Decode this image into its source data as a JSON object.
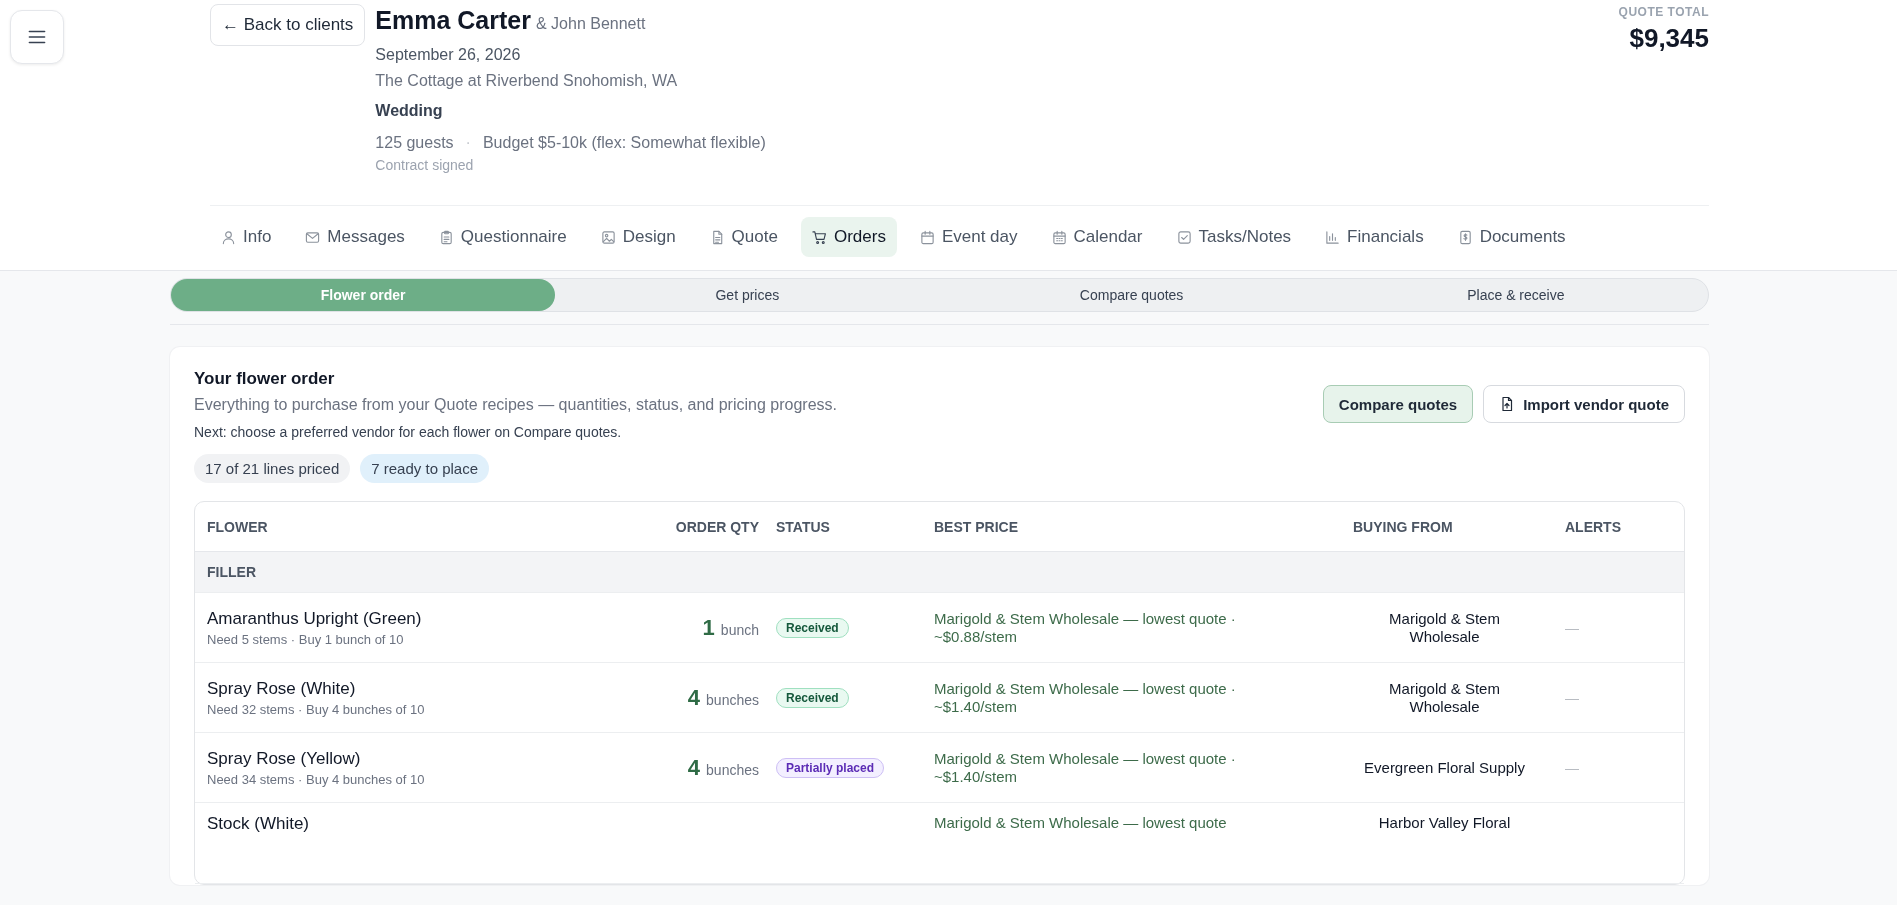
{
  "back_button": {
    "label": "← Back to clients"
  },
  "client": {
    "name": "Emma Carter",
    "partner": "& John Bennett",
    "date": "September 26, 2026",
    "venue": "The Cottage at Riverbend Snohomish, WA",
    "event_type": "Wedding",
    "guests": "125 guests",
    "separator": "·",
    "budget": "Budget $5-10k (flex: Somewhat flexible)",
    "contract": "Contract signed"
  },
  "quote_total": {
    "label": "QUOTE TOTAL",
    "value": "$9,345"
  },
  "tabs": [
    {
      "label": "Info",
      "selected": false
    },
    {
      "label": "Messages",
      "selected": false
    },
    {
      "label": "Questionnaire",
      "selected": false
    },
    {
      "label": "Design",
      "selected": false
    },
    {
      "label": "Quote",
      "selected": false
    },
    {
      "label": "Orders",
      "selected": true
    },
    {
      "label": "Event day",
      "selected": false
    },
    {
      "label": "Calendar",
      "selected": false
    },
    {
      "label": "Tasks/Notes",
      "selected": false
    },
    {
      "label": "Financials",
      "selected": false
    },
    {
      "label": "Documents",
      "selected": false
    }
  ],
  "steps": [
    {
      "label": "Flower order",
      "selected": true
    },
    {
      "label": "Get prices",
      "selected": false
    },
    {
      "label": "Compare quotes",
      "selected": false
    },
    {
      "label": "Place & receive",
      "selected": false
    }
  ],
  "order": {
    "title": "Your flower order",
    "subtitle": "Everything to purchase from your Quote recipes — quantities, status, and pricing progress.",
    "next": "Next: choose a preferred vendor for each flower on Compare quotes.",
    "buttons": [
      {
        "label": "Compare quotes",
        "kind": "primary"
      },
      {
        "label": "Import vendor quote",
        "kind": "import"
      }
    ],
    "badges": [
      {
        "label": "17 of 21 lines priced",
        "color": "#f1f2f4"
      },
      {
        "label": "7 ready to place",
        "color": "#e0f0fb"
      }
    ]
  },
  "table": {
    "columns": [
      "FLOWER",
      "ORDER QTY",
      "STATUS",
      "BEST PRICE",
      "BUYING FROM",
      "ALERTS"
    ],
    "groups": [
      {
        "name": "FILLER",
        "rows": [
          {
            "flower": "Amaranthus Upright (Green)",
            "detail": "Need 5 stems · Buy 1 bunch of 10",
            "qty": "1",
            "unit": "bunch",
            "status": {
              "label": "Received",
              "kind": "received"
            },
            "best_price": [
              "Marigold & Stem Wholesale — lowest quote ·",
              "~$0.88/stem"
            ],
            "buying_from": "Marigold & Stem Wholesale",
            "alerts": "—"
          },
          {
            "flower": "Spray Rose (White)",
            "detail": "Need 32 stems · Buy 4 bunches of 10",
            "qty": "4",
            "unit": "bunches",
            "status": {
              "label": "Received",
              "kind": "received"
            },
            "best_price": [
              "Marigold & Stem Wholesale — lowest quote ·",
              "~$1.40/stem"
            ],
            "buying_from": "Marigold & Stem Wholesale",
            "alerts": "—"
          },
          {
            "flower": "Spray Rose (Yellow)",
            "detail": "Need 34 stems · Buy 4 bunches of 10",
            "qty": "4",
            "unit": "bunches",
            "status": {
              "label": "Partially placed",
              "kind": "partial"
            },
            "best_price": [
              "Marigold & Stem Wholesale — lowest quote ·",
              "~$1.40/stem"
            ],
            "buying_from": "Evergreen Floral Supply",
            "alerts": "—"
          },
          {
            "flower": "Stock (White)",
            "best_price": [
              "Marigold & Stem Wholesale — lowest quote"
            ],
            "buying_from": "Harbor Valley Floral"
          }
        ]
      }
    ]
  }
}
